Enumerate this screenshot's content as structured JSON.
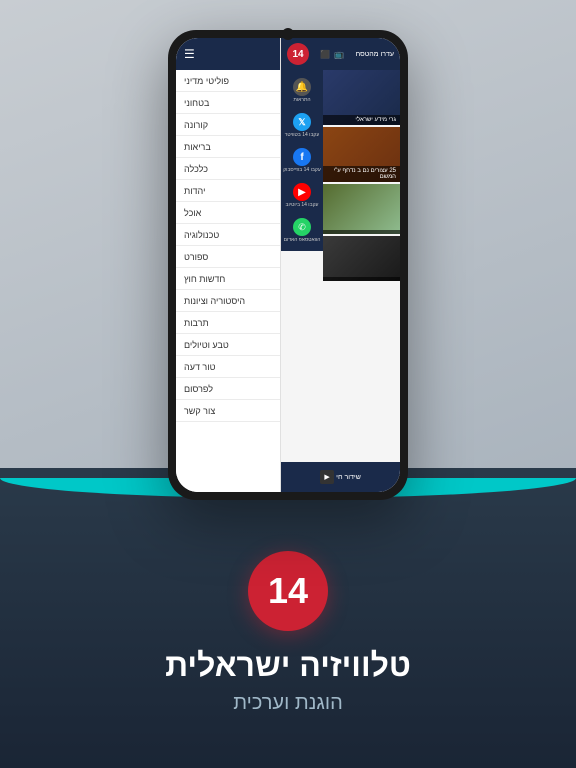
{
  "app": {
    "logo_number": "14",
    "main_title": "טלוויזיה ישראלית",
    "sub_title": "הוגנת וערכית"
  },
  "sidebar": {
    "menu_items": [
      {
        "label": "פוליטי מדיני"
      },
      {
        "label": "בטחוני"
      },
      {
        "label": "קורונה"
      },
      {
        "label": "בריאות"
      },
      {
        "label": "כלכלה"
      },
      {
        "label": "יהדות"
      },
      {
        "label": "אוכל"
      },
      {
        "label": "טכנולוגיה"
      },
      {
        "label": "ספורט"
      },
      {
        "label": "חדשות חוץ"
      },
      {
        "label": "היסטוריה וציונות"
      },
      {
        "label": "תרבות"
      },
      {
        "label": "טבע וטיולים"
      },
      {
        "label": "טור דעה"
      },
      {
        "label": "לפרסום"
      },
      {
        "label": "צור קשר"
      }
    ]
  },
  "social_panel": {
    "items": [
      {
        "icon": "bell",
        "label": "התראות",
        "symbol": "🔔"
      },
      {
        "icon": "twitter",
        "label": "עקבו 14\nבטוויטר",
        "symbol": "𝕏"
      },
      {
        "icon": "facebook",
        "label": "עקבו 14\nבפייסבוק",
        "symbol": "f"
      },
      {
        "icon": "youtube",
        "label": "עקבו 14\nביוטיוב",
        "symbol": "▶"
      },
      {
        "icon": "whatsapp",
        "label": "הוואטסאפ\nהאדום",
        "symbol": "✆"
      }
    ]
  },
  "news": {
    "items": [
      {
        "text": "גרי מידע ישראלי",
        "style": "dark-blue"
      },
      {
        "text": "25 עצורים נם ב\nנדחף ע\"י המשם",
        "style": "brown"
      },
      {
        "text": "",
        "style": "olive"
      },
      {
        "text": "",
        "style": "dark"
      }
    ]
  },
  "bottom_bar": {
    "live_label": "שידור חי"
  },
  "top_bar": {
    "right_text": "עדרו\nמהטסח"
  }
}
